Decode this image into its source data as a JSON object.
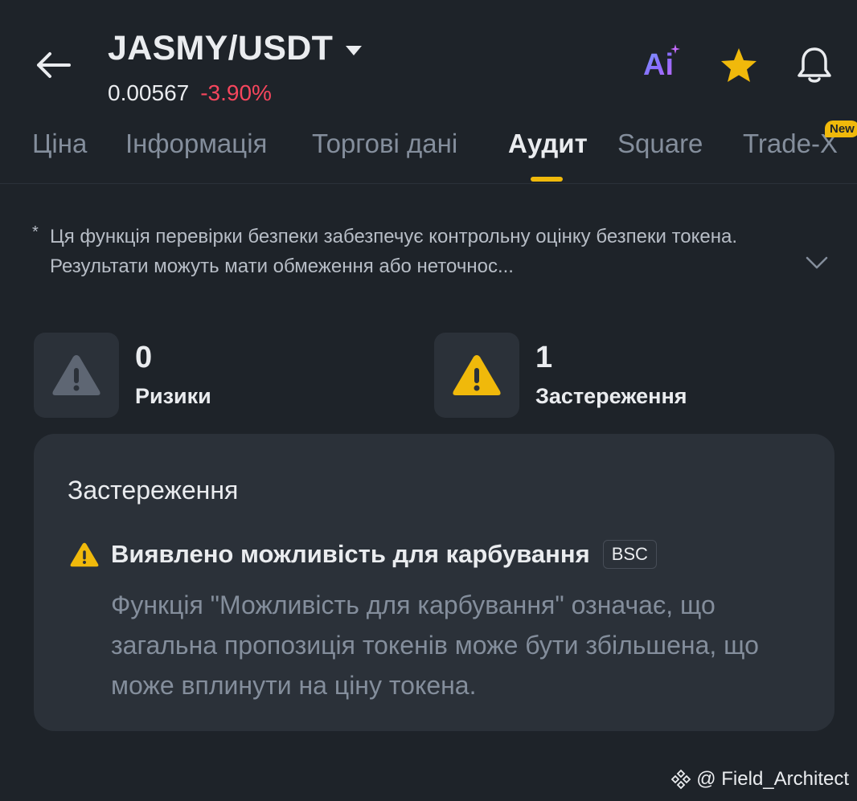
{
  "header": {
    "pair": "JASMY/USDT",
    "price": "0.00567",
    "change": "-3.90%",
    "ai_label": "Ai"
  },
  "tabs": [
    {
      "label": "Ціна"
    },
    {
      "label": "Інформація"
    },
    {
      "label": "Торгові дані"
    },
    {
      "label": "Аудит",
      "active": true
    },
    {
      "label": "Square"
    },
    {
      "label": "Trade-X"
    }
  ],
  "new_badge": "New",
  "disclaimer": {
    "star": "*",
    "text": "Ця функція перевірки безпеки забезпечує контрольну оцінку безпеки токена. Результати можуть мати обмеження або неточнос..."
  },
  "stats": {
    "risks": {
      "count": "0",
      "label": "Ризики"
    },
    "warnings": {
      "count": "1",
      "label": "Застереження"
    }
  },
  "card": {
    "title": "Застереження",
    "item": {
      "title": "Виявлено можливість для карбування",
      "chain": "BSC",
      "description": "Функція \"Можливість для карбування\" означає, що загальна пропозиція токенів може бути збільшена, що може вплинути на ціну токена."
    }
  },
  "watermark": "@ Field_Architect",
  "colors": {
    "background": "#1e2329",
    "accent": "#f0b90b",
    "negative": "#f6465d",
    "muted": "#848e9c"
  },
  "icons": [
    "back-arrow-icon",
    "caret-down-icon",
    "ai-icon",
    "star-icon",
    "bell-icon",
    "chevron-down-icon",
    "warning-icon",
    "binance-logo-icon"
  ]
}
